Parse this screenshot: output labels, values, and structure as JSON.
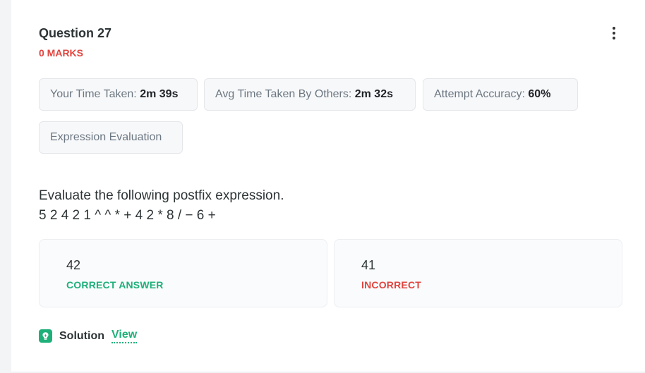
{
  "question": {
    "title": "Question 27",
    "marks": "0 MARKS"
  },
  "stats": {
    "your_time_label": "Your Time Taken:",
    "your_time_value": "2m 39s",
    "avg_time_label": "Avg Time Taken By Others:",
    "avg_time_value": "2m 32s",
    "accuracy_label": "Attempt Accuracy:",
    "accuracy_value": "60%"
  },
  "tag": "Expression Evaluation",
  "body": {
    "prompt": "Evaluate the following postfix expression.",
    "expression": "5 2 4 2 1 ^ ^ * + 4 2 * 8 / − 6 +"
  },
  "options": [
    {
      "value": "42",
      "status": "CORRECT ANSWER",
      "status_color": "#1fb07a"
    },
    {
      "value": "41",
      "status": "INCORRECT",
      "status_color": "#e1453f"
    }
  ],
  "solution": {
    "label": "Solution",
    "link": "View",
    "icon": "lightbulb-icon"
  },
  "colors": {
    "accent_green": "#1fb07a",
    "accent_red": "#e1453f"
  }
}
